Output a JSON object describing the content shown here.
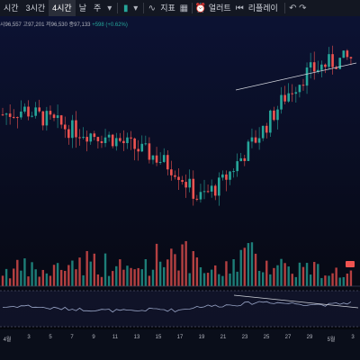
{
  "toolbar": {
    "timeframes": [
      "시간",
      "3시간",
      "4시간",
      "날",
      "주"
    ],
    "active_timeframe": "4시간",
    "indicators_label": "지표",
    "alert_label": "얼러트",
    "replay_label": "리플레이",
    "icons": [
      "dropdown-chevron-icon",
      "candle-type-icon",
      "chart-style-icon",
      "indicators-icon",
      "templates-icon",
      "alert-icon",
      "replay-icon",
      "undo-icon",
      "redo-icon"
    ]
  },
  "ohlc": {
    "open": "시96,557",
    "high": "고97,201",
    "low": "저96,530",
    "close": "종97,133",
    "change": "+598 (+0.62%)"
  },
  "colors": {
    "up": "#26a69a",
    "down": "#ef5350",
    "background_top": "#0b1029",
    "background_bottom": "#05070f",
    "rsi_line": "#9aa6c8",
    "trendline": "#d1d4dc"
  },
  "x_axis_labels": [
    "4월",
    "3",
    "5",
    "7",
    "9",
    "11",
    "13",
    "15",
    "17",
    "19",
    "21",
    "23",
    "25",
    "27",
    "29",
    "5월",
    "3"
  ],
  "chart_data": {
    "type": "candlestick",
    "title": "",
    "xlabel": "",
    "ylabel": "",
    "x": [
      "4월",
      "3",
      "5",
      "7",
      "9",
      "11",
      "13",
      "15",
      "17",
      "19",
      "21",
      "23",
      "25",
      "27",
      "29",
      "5월",
      "3"
    ],
    "series": [
      {
        "values": [
          58,
          60,
          56,
          52,
          50,
          48,
          44,
          40,
          34,
          22,
          28,
          40,
          52,
          66,
          76,
          80,
          82
        ]
      }
    ],
    "rsi_series": [
      {
        "values": [
          48,
          52,
          46,
          44,
          42,
          40,
          38,
          44,
          40,
          50,
          52,
          56,
          62,
          58,
          56,
          54,
          60
        ]
      }
    ],
    "volume_series": [
      {
        "values": [
          12,
          14,
          10,
          18,
          20,
          16,
          12,
          22,
          30,
          14,
          10,
          26,
          20,
          16,
          14,
          12,
          10
        ]
      }
    ],
    "grid": false,
    "trendlines": 2
  }
}
